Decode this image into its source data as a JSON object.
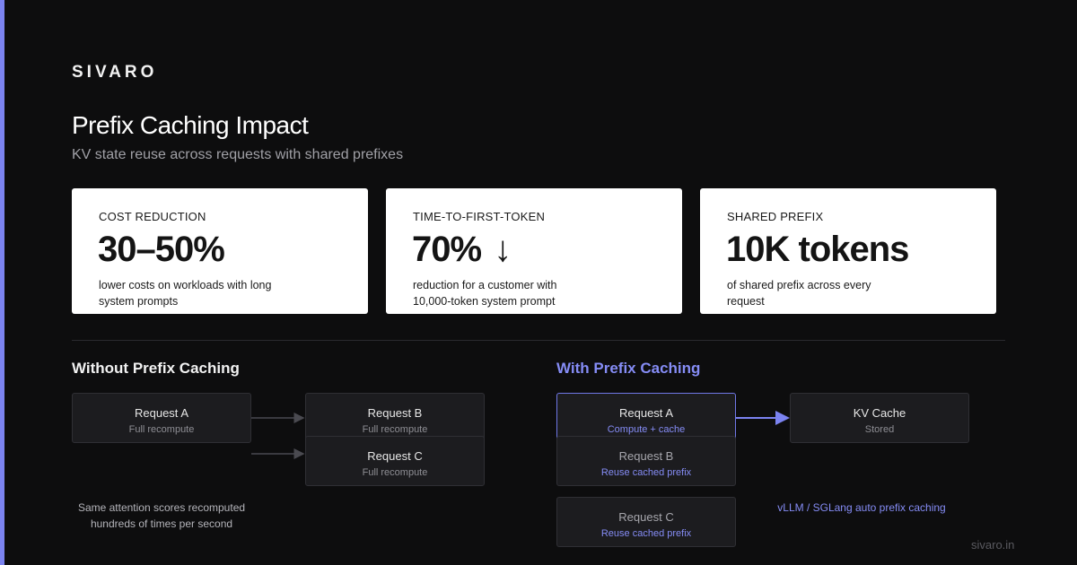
{
  "brand": "SIVARO",
  "title": "Prefix Caching Impact",
  "subtitle": "KV state reuse across requests with shared prefixes",
  "cards": [
    {
      "label": "COST REDUCTION",
      "value": "30–50%",
      "desc": "lower costs on workloads with long system prompts"
    },
    {
      "label": "TIME-TO-FIRST-TOKEN",
      "value": "70%",
      "value_icon": "↓",
      "desc": "reduction for a customer with 10,000-token system prompt"
    },
    {
      "label": "SHARED PREFIX",
      "value": "10K tokens",
      "desc": "of shared prefix across every request"
    }
  ],
  "without": {
    "title": "Without Prefix Caching",
    "request_a": {
      "title": "Request A",
      "sub": "Full recompute"
    },
    "request_b": {
      "title": "Request B",
      "sub": "Full recompute"
    },
    "request_c": {
      "title": "Request C",
      "sub": "Full recompute"
    },
    "note": "Same attention scores recomputed hundreds of times per second"
  },
  "with": {
    "title": "With Prefix Caching",
    "request_a": {
      "title": "Request A",
      "sub": "Compute + cache"
    },
    "kv_cache": {
      "title": "KV Cache",
      "sub": "Stored"
    },
    "request_b": {
      "title": "Request B",
      "sub": "Reuse cached prefix"
    },
    "request_c": {
      "title": "Request C",
      "sub": "Reuse cached prefix"
    },
    "note": "vLLM / SGLang auto prefix caching"
  },
  "footer": {
    "domain": "sivaro.in"
  },
  "colors": {
    "accent": "#7b83f0",
    "background": "#0d0d0e",
    "card_bg": "#ffffff",
    "node_bg": "#1c1c1f"
  }
}
